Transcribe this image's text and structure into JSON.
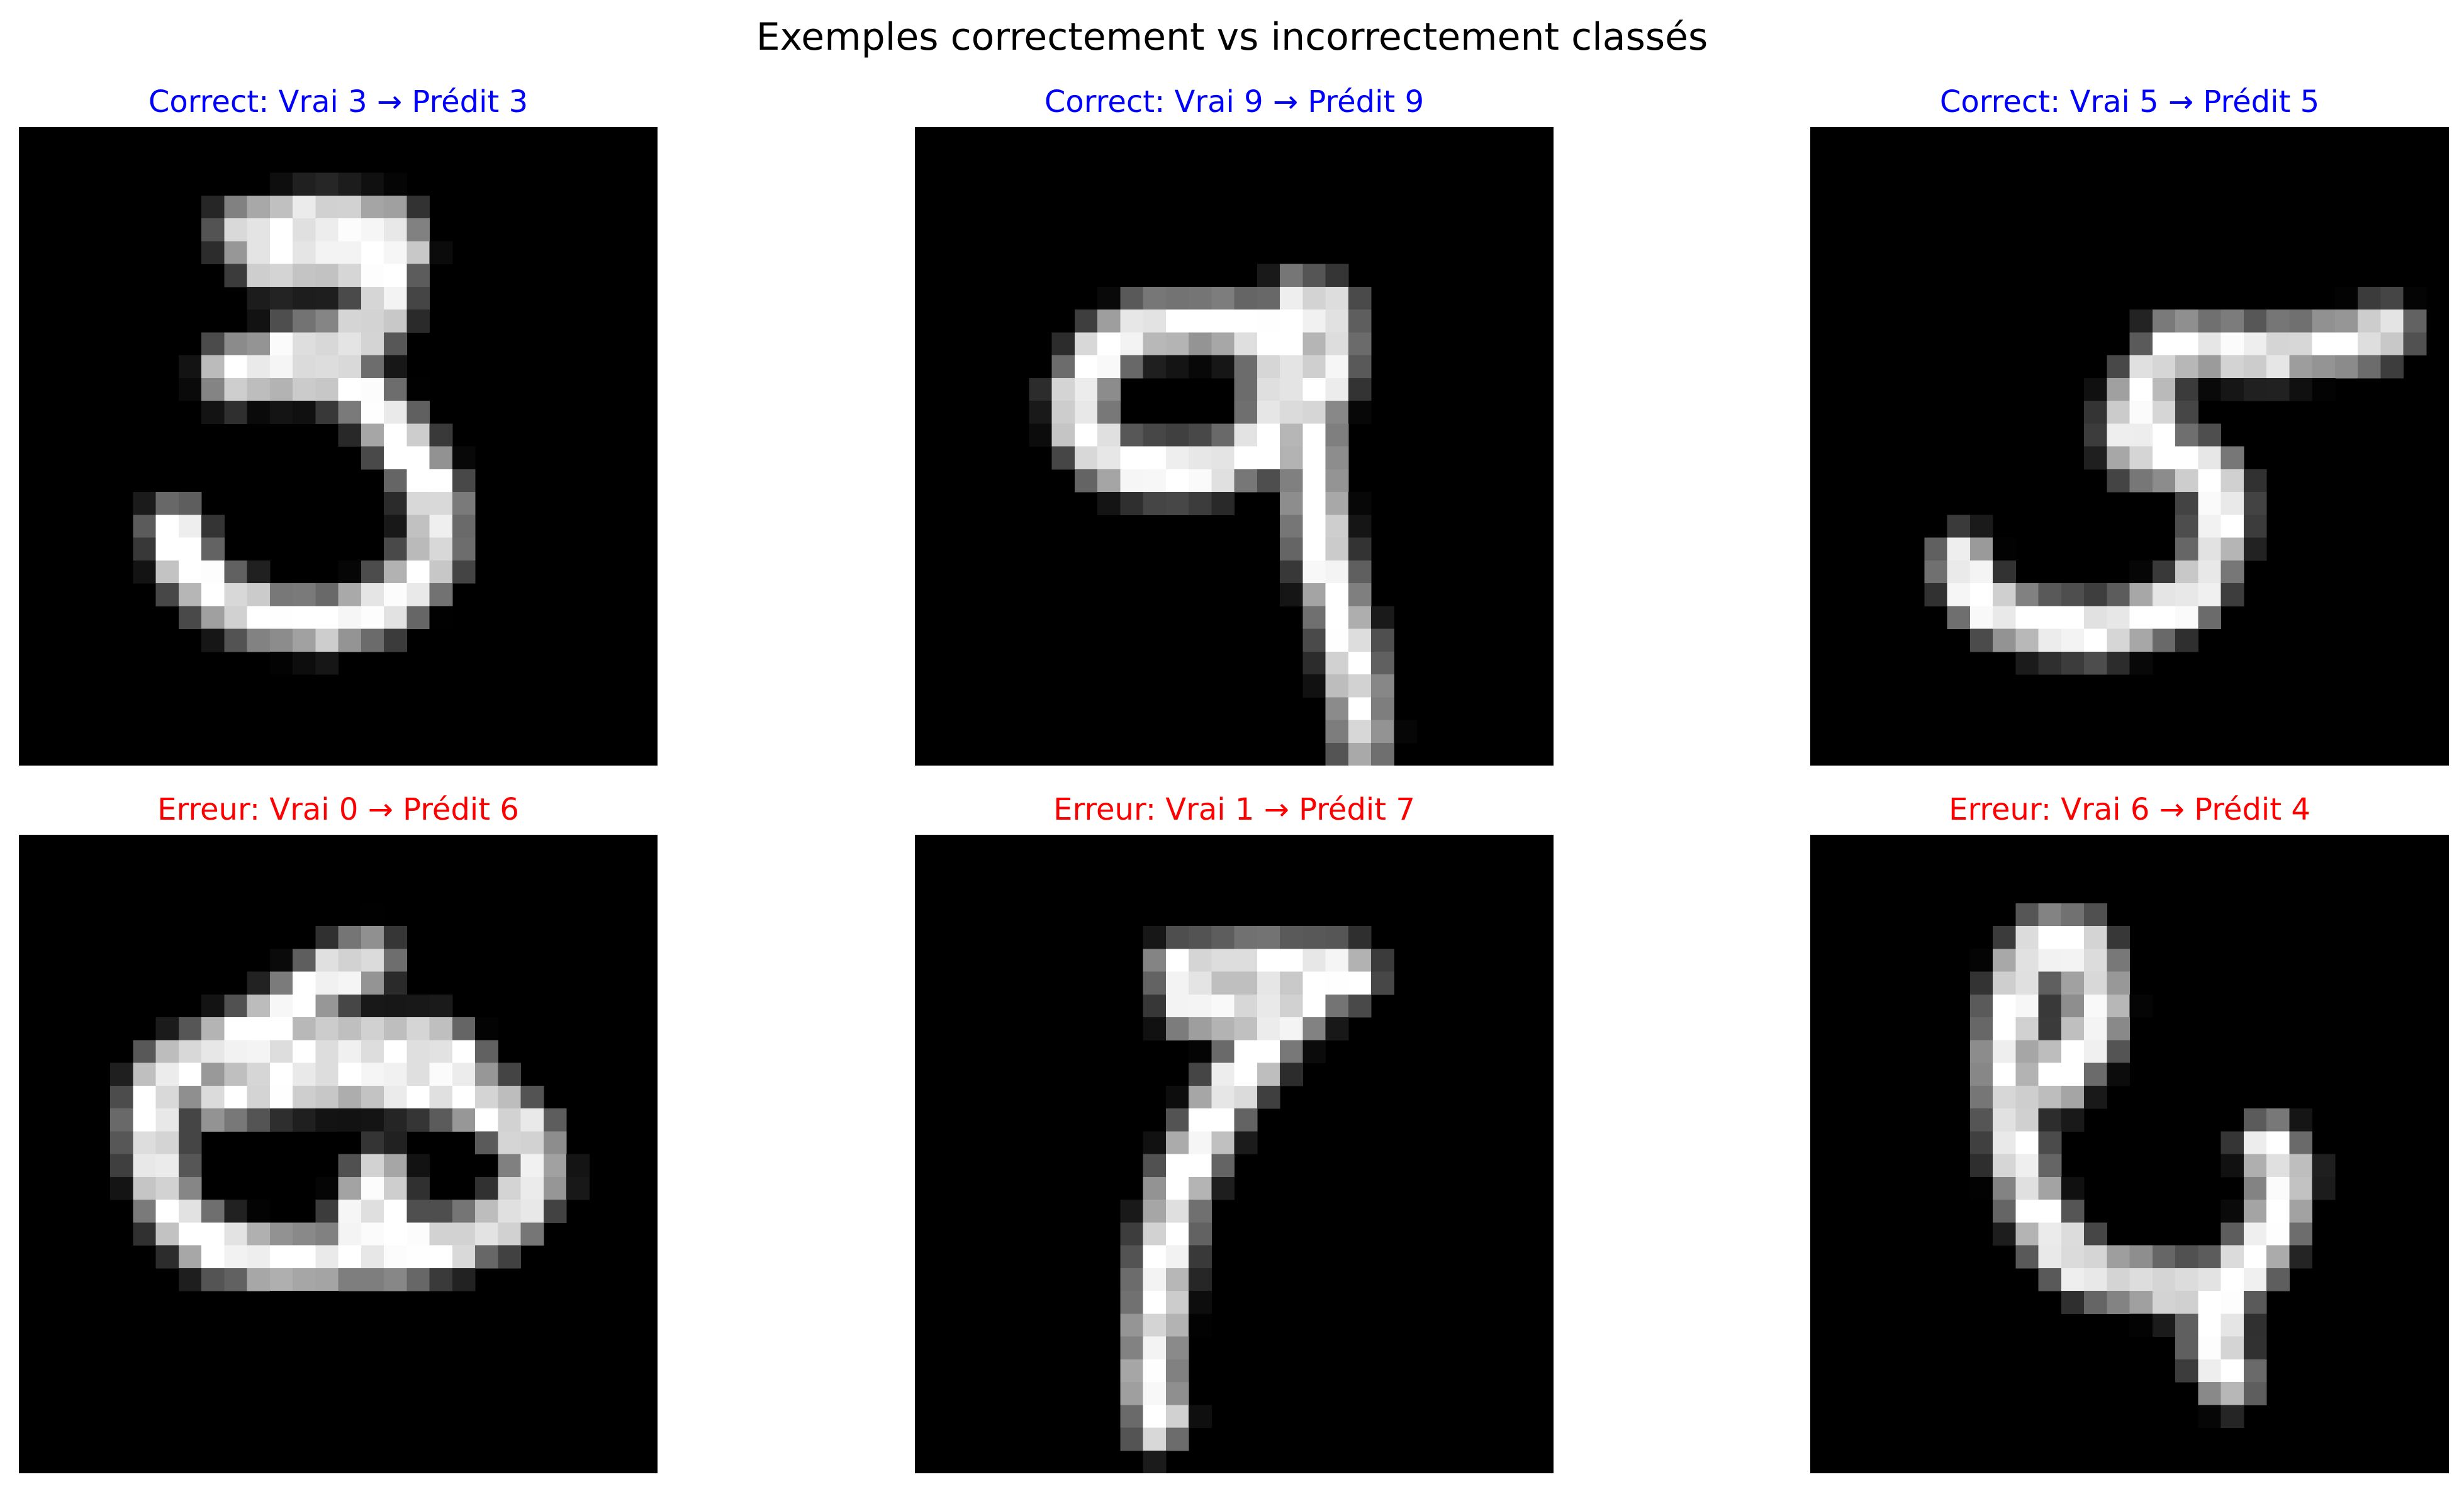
{
  "figure_title": "Exemples correctement vs incorrectement classés",
  "colors": {
    "correct": "#0000ff",
    "error": "#ff0000",
    "image_background": "#000000"
  },
  "panels": [
    {
      "title": "Correct: Vrai 3 → Prédit 3",
      "status": "correct",
      "true_label": 3,
      "predicted_label": 3,
      "strokes": [
        [
          [
            5.6,
            2.6
          ],
          [
            7.4,
            2.4
          ],
          [
            9.2,
            2.5
          ],
          [
            9.5,
            3.1
          ]
        ],
        [
          [
            6.2,
            3.3
          ],
          [
            7.6,
            3.3
          ],
          [
            9.2,
            3.3
          ],
          [
            9.1,
            4.6
          ],
          [
            8.3,
            5.4
          ],
          [
            7.3,
            5.5
          ],
          [
            6.2,
            5.9
          ],
          [
            5.3,
            6.2
          ]
        ],
        [
          [
            5.4,
            6.0
          ],
          [
            6.4,
            6.1
          ],
          [
            7.6,
            6.1
          ],
          [
            8.6,
            6.6
          ],
          [
            9.4,
            7.6
          ],
          [
            10.1,
            8.6
          ],
          [
            10.5,
            9.6
          ],
          [
            10.4,
            10.7
          ],
          [
            9.9,
            11.4
          ],
          [
            9.0,
            12.1
          ],
          [
            7.6,
            12.4
          ],
          [
            6.2,
            12.3
          ],
          [
            5.0,
            11.8
          ],
          [
            4.2,
            11.0
          ],
          [
            3.9,
            10.1
          ]
        ]
      ]
    },
    {
      "title": "Correct: Vrai 9 → Prédit 9",
      "status": "correct",
      "true_label": 9,
      "predicted_label": 9,
      "strokes": [
        [
          [
            9.0,
            5.2
          ],
          [
            7.4,
            4.9
          ],
          [
            5.8,
            5.0
          ],
          [
            4.7,
            5.6
          ],
          [
            4.1,
            6.6
          ],
          [
            4.2,
            7.6
          ],
          [
            4.9,
            8.4
          ],
          [
            6.2,
            8.6
          ],
          [
            7.6,
            8.5
          ],
          [
            8.7,
            8.0
          ],
          [
            9.0,
            6.9
          ],
          [
            9.0,
            5.2
          ],
          [
            9.6,
            4.4
          ],
          [
            10.4,
            4.6
          ],
          [
            10.5,
            5.6
          ],
          [
            10.2,
            6.6
          ]
        ],
        [
          [
            9.2,
            5.4
          ],
          [
            9.6,
            6.4
          ],
          [
            9.9,
            7.6
          ],
          [
            10.0,
            8.8
          ],
          [
            10.1,
            10.0
          ],
          [
            10.3,
            11.0
          ],
          [
            10.6,
            12.0
          ],
          [
            10.9,
            13.1
          ],
          [
            11.1,
            14.2
          ],
          [
            11.2,
            15.2
          ]
        ]
      ]
    },
    {
      "title": "Correct: Vrai 5 → Prédit 5",
      "status": "correct",
      "true_label": 5,
      "predicted_label": 5,
      "strokes": [
        [
          [
            9.1,
            5.4
          ],
          [
            10.1,
            5.5
          ],
          [
            11.3,
            5.6
          ],
          [
            12.5,
            5.5
          ],
          [
            13.6,
            5.4
          ],
          [
            14.4,
            5.1
          ]
        ],
        [
          [
            9.1,
            5.6
          ],
          [
            8.6,
            6.2
          ],
          [
            8.1,
            7.0
          ],
          [
            8.0,
            7.8
          ],
          [
            8.8,
            8.2
          ],
          [
            9.6,
            8.4
          ],
          [
            10.2,
            8.9
          ],
          [
            10.3,
            9.9
          ],
          [
            10.0,
            11.0
          ],
          [
            9.4,
            11.9
          ],
          [
            8.3,
            12.3
          ],
          [
            7.2,
            12.6
          ],
          [
            6.0,
            12.5
          ],
          [
            4.9,
            12.3
          ],
          [
            4.1,
            11.7
          ],
          [
            3.8,
            10.9
          ]
        ],
        [
          [
            8.3,
            8.2
          ],
          [
            8.6,
            7.4
          ]
        ]
      ]
    },
    {
      "title": "Erreur: Vrai 0 → Prédit 6",
      "status": "error",
      "true_label": 0,
      "predicted_label": 6,
      "strokes": [
        [
          [
            8.7,
            3.1
          ],
          [
            7.6,
            3.7
          ],
          [
            6.6,
            4.5
          ],
          [
            5.6,
            5.1
          ],
          [
            4.5,
            5.6
          ],
          [
            3.6,
            6.0
          ],
          [
            3.3,
            7.1
          ],
          [
            3.5,
            8.4
          ],
          [
            3.9,
            9.5
          ],
          [
            4.8,
            10.3
          ],
          [
            6.2,
            10.6
          ],
          [
            7.8,
            10.6
          ],
          [
            9.4,
            10.5
          ],
          [
            10.9,
            10.2
          ],
          [
            12.3,
            9.6
          ],
          [
            13.0,
            8.6
          ],
          [
            12.8,
            7.6
          ],
          [
            11.9,
            6.8
          ],
          [
            10.6,
            6.3
          ],
          [
            9.0,
            6.1
          ],
          [
            7.4,
            6.1
          ],
          [
            6.0,
            6.3
          ],
          [
            4.9,
            6.6
          ]
        ],
        [
          [
            6.2,
            5.2
          ],
          [
            7.6,
            5.3
          ],
          [
            9.2,
            5.3
          ],
          [
            10.6,
            5.3
          ],
          [
            11.2,
            5.9
          ]
        ],
        [
          [
            8.3,
            10.4
          ],
          [
            8.6,
            9.6
          ],
          [
            9.0,
            8.6
          ],
          [
            9.2,
            9.6
          ],
          [
            9.1,
            10.4
          ]
        ]
      ]
    },
    {
      "title": "Erreur: Vrai 1 → Prédit 7",
      "status": "error",
      "true_label": 1,
      "predicted_label": 7,
      "strokes": [
        [
          [
            6.6,
            3.4
          ],
          [
            8.0,
            3.3
          ],
          [
            9.4,
            3.3
          ],
          [
            10.6,
            3.3
          ],
          [
            10.9,
            3.5
          ]
        ],
        [
          [
            6.9,
            4.3
          ],
          [
            8.0,
            4.4
          ],
          [
            9.0,
            4.5
          ],
          [
            9.6,
            4.4
          ],
          [
            10.2,
            3.8
          ]
        ],
        [
          [
            9.4,
            4.4
          ],
          [
            8.8,
            5.3
          ],
          [
            7.9,
            6.4
          ],
          [
            7.2,
            7.6
          ],
          [
            6.6,
            8.9
          ],
          [
            6.3,
            10.2
          ],
          [
            6.1,
            11.5
          ],
          [
            6.0,
            12.7
          ],
          [
            6.0,
            13.9
          ],
          [
            6.1,
            14.7
          ]
        ]
      ]
    },
    {
      "title": "Erreur: Vrai 6 → Prédit 4",
      "status": "error",
      "true_label": 6,
      "predicted_label": 4,
      "strokes": [
        [
          [
            6.0,
            2.6
          ],
          [
            5.4,
            3.3
          ],
          [
            5.0,
            4.4
          ],
          [
            4.9,
            5.6
          ],
          [
            5.0,
            6.8
          ],
          [
            5.2,
            8.0
          ],
          [
            5.5,
            9.1
          ],
          [
            6.0,
            10.0
          ],
          [
            6.6,
            10.7
          ],
          [
            7.4,
            11.1
          ],
          [
            8.5,
            11.2
          ],
          [
            9.6,
            11.4
          ],
          [
            10.4,
            11.3
          ],
          [
            11.1,
            10.7
          ],
          [
            11.6,
            9.8
          ],
          [
            11.9,
            8.6
          ],
          [
            11.5,
            7.8
          ]
        ],
        [
          [
            6.0,
            2.6
          ],
          [
            6.8,
            2.7
          ],
          [
            7.1,
            3.4
          ],
          [
            7.2,
            4.4
          ],
          [
            7.0,
            5.2
          ],
          [
            6.5,
            5.6
          ],
          [
            6.2,
            6.2
          ]
        ],
        [
          [
            10.4,
            11.3
          ],
          [
            10.2,
            12.2
          ],
          [
            10.2,
            13.0
          ],
          [
            10.5,
            13.6
          ]
        ]
      ]
    }
  ]
}
